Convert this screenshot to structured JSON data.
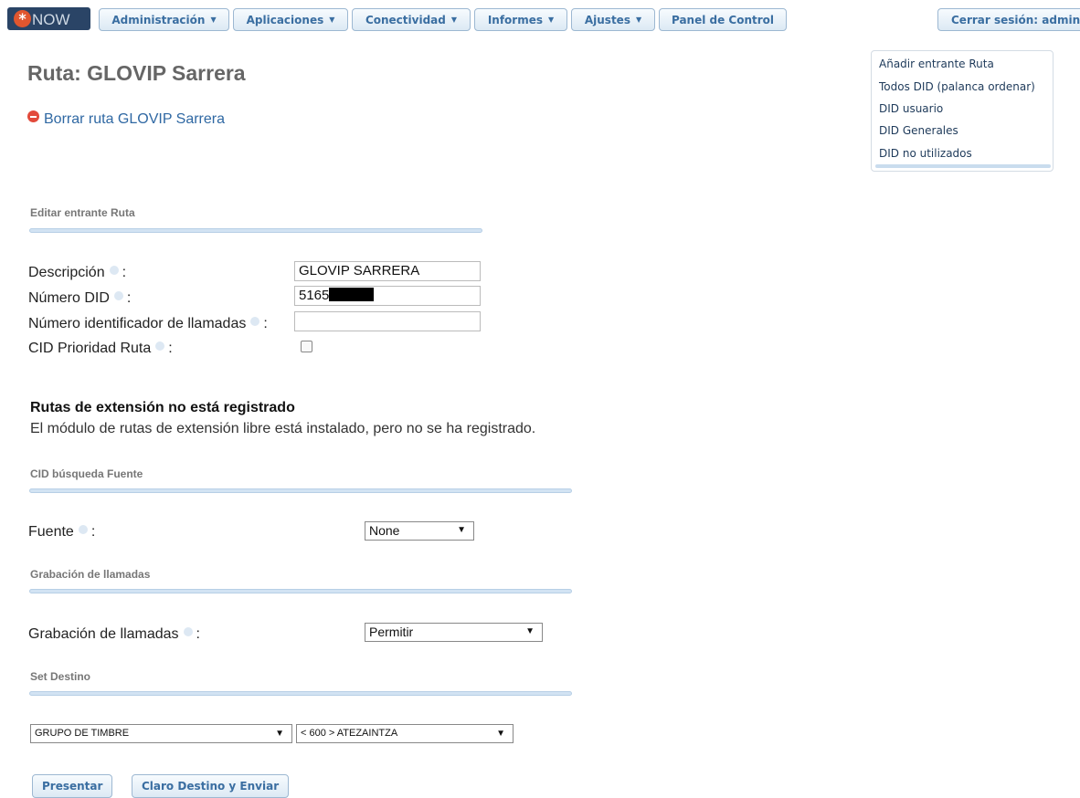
{
  "nav": {
    "logo_text": "NOW",
    "logo_mark": "*",
    "items": [
      {
        "label": "Administración",
        "icon": "chevron-down-icon"
      },
      {
        "label": "Aplicaciones",
        "icon": "chevron-down-icon"
      },
      {
        "label": "Conectividad",
        "icon": "chevron-down-icon"
      },
      {
        "label": "Informes",
        "icon": "chevron-down-icon"
      },
      {
        "label": "Ajustes",
        "icon": "chevron-down-icon"
      },
      {
        "label": "Panel de Control"
      }
    ],
    "logout": "Cerrar sesión: admin"
  },
  "sidebar": {
    "items": [
      {
        "label": "Añadir entrante Ruta"
      },
      {
        "label": "Todos DID (palanca ordenar)"
      },
      {
        "label": "DID usuario"
      },
      {
        "label": "DID Generales"
      },
      {
        "label": "DID no utilizados"
      }
    ]
  },
  "page": {
    "title": "Ruta: GLOVIP Sarrera",
    "delete_link": "Borrar ruta GLOVIP Sarrera"
  },
  "edit_section": {
    "heading": "Editar entrante Ruta",
    "fields": {
      "description": {
        "label": "Descripción",
        "value": "GLOVIP SARRERA"
      },
      "did": {
        "label": "Número DID",
        "value": "5165"
      },
      "cid": {
        "label": "Número identificador de llamadas",
        "value": ""
      },
      "priority": {
        "label": "CID Prioridad Ruta",
        "checked": false
      }
    }
  },
  "warning": {
    "title": "Rutas de extensión no está registrado",
    "body": "El módulo de rutas de extensión libre está instalado, pero no se ha registrado."
  },
  "cid_section": {
    "heading": "CID búsqueda Fuente",
    "source_label": "Fuente",
    "source_value": "None"
  },
  "recording_section": {
    "heading": "Grabación de llamadas",
    "label": "Grabación de llamadas",
    "value": "Permitir"
  },
  "destination_section": {
    "heading": "Set Destino",
    "type_value": "GRUPO DE TIMBRE",
    "target_value": "< 600 > ATEZAINTZA"
  },
  "buttons": {
    "submit": "Presentar",
    "clear": "Claro Destino y Enviar"
  },
  "colors": {
    "accent": "#3a6ea1",
    "logo_bg": "#2a4466",
    "delete_icon": "#e24a3b"
  }
}
